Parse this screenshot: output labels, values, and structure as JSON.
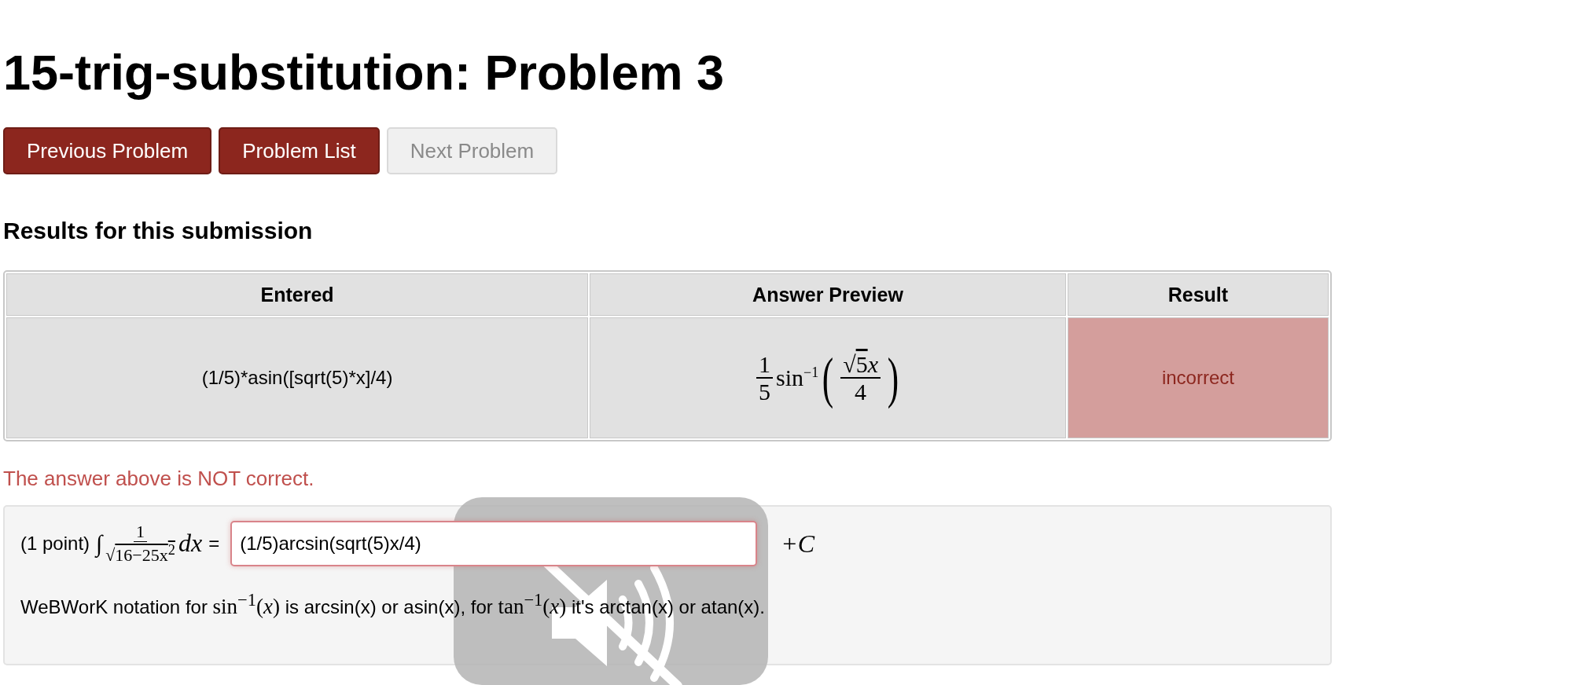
{
  "title": "15-trig-substitution: Problem 3",
  "nav_buttons": [
    {
      "label": "Previous Problem",
      "disabled": false
    },
    {
      "label": "Problem List",
      "disabled": false
    },
    {
      "label": "Next Problem",
      "disabled": true
    }
  ],
  "results_heading": "Results for this submission",
  "results_table": {
    "columns": [
      "Entered",
      "Answer Preview",
      "Result"
    ],
    "rows": [
      {
        "entered": "(1/5)*asin([sqrt(5)*x]/4)",
        "preview": {
          "coef_num": "1",
          "coef_den": "5",
          "func": "sin",
          "power": "−1",
          "open_paren": "(",
          "close_paren": ")",
          "radical": "√",
          "radicand": "5",
          "variable": "x",
          "den": "4"
        },
        "result": "incorrect",
        "correct": false
      }
    ]
  },
  "feedback": "The answer above is NOT correct.",
  "problem": {
    "points": "(1 point)",
    "integral": "∫",
    "frac_num": "1",
    "radical": "√",
    "frac_den": "16−25x$^{2}$",
    "dx": "dx",
    "equals": "=",
    "answer_value": "(1/5)arcsin(sqrt(5)x/4)",
    "constant": "+C",
    "note": [
      {
        "kind": "text",
        "s": "WeBWorK notation for "
      },
      {
        "kind": "math",
        "s": "sin$^{−1}$(*x*)"
      },
      {
        "kind": "text",
        "s": " is arcsin(x) or asin(x), for "
      },
      {
        "kind": "math",
        "s": "tan$^{−1}$(*x*)"
      },
      {
        "kind": "text",
        "s": " it's arctan(x) or atan(x)."
      }
    ]
  },
  "overlay": {
    "kind": "mute"
  }
}
